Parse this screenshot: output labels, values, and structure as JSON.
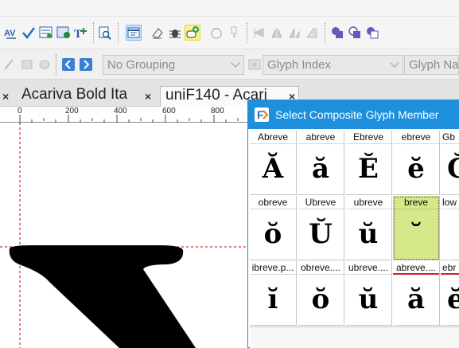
{
  "toolbar": {
    "combo_grouping": "No Grouping",
    "combo_sort": "Glyph Index",
    "combo_name": "Glyph Name"
  },
  "tabs": [
    {
      "label": "Acariva Bold Ita"
    },
    {
      "label": "uniF140 - Acari"
    }
  ],
  "ruler": {
    "labels": [
      "0",
      "200",
      "400",
      "600",
      "800"
    ]
  },
  "dialog": {
    "title": "Select Composite Glyph Member",
    "cells": [
      {
        "name": "Abreve",
        "glyph": "Ă"
      },
      {
        "name": "abreve",
        "glyph": "ă"
      },
      {
        "name": "Ebreve",
        "glyph": "Ĕ"
      },
      {
        "name": "ebreve",
        "glyph": "ĕ"
      },
      {
        "name": "Gb",
        "glyph": "Ğ"
      },
      {
        "name": "obreve",
        "glyph": "ŏ"
      },
      {
        "name": "Ubreve",
        "glyph": "Ŭ"
      },
      {
        "name": "ubreve",
        "glyph": "ŭ"
      },
      {
        "name": "breve",
        "glyph": "˘"
      },
      {
        "name": "low",
        "glyph": ""
      },
      {
        "name": "ibreve.p...",
        "glyph": "ĭ"
      },
      {
        "name": "obreve....",
        "glyph": "ŏ"
      },
      {
        "name": "ubreve....",
        "glyph": "ŭ"
      },
      {
        "name": "abreve....",
        "glyph": "ă"
      },
      {
        "name": "ebr",
        "glyph": "ĕ"
      }
    ]
  },
  "colors": {
    "dialog_title_bg": "#1e8fdc",
    "selected_cell_bg": "#d5e88a",
    "guide_red": "#cc0000"
  }
}
